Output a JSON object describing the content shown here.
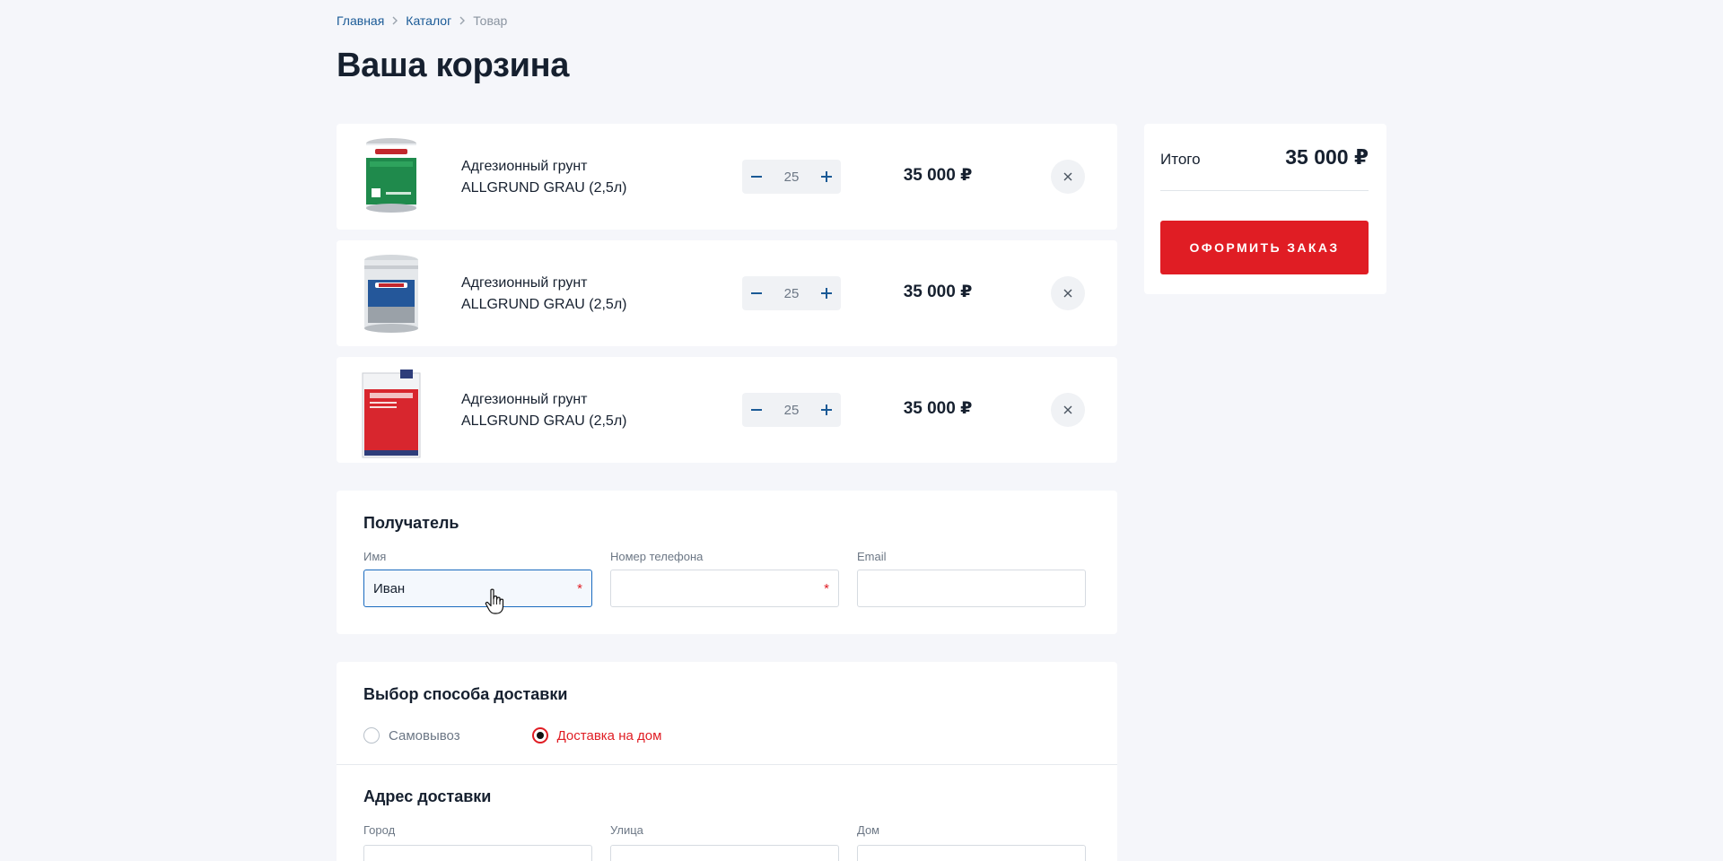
{
  "breadcrumb": {
    "home": "Главная",
    "catalog": "Каталог",
    "current": "Товар"
  },
  "page_title": "Ваша корзина",
  "cart": {
    "items": [
      {
        "name_line1": "Адгезионный грунт",
        "name_line2": "ALLGRUND GRAU (2,5л)",
        "qty": "25",
        "price": "35 000 ₽",
        "image": "green-paint-can"
      },
      {
        "name_line1": "Адгезионный грунт",
        "name_line2": "ALLGRUND GRAU (2,5л)",
        "qty": "25",
        "price": "35 000 ₽",
        "image": "silver-paint-bucket"
      },
      {
        "name_line1": "Адгезионный грунт",
        "name_line2": "ALLGRUND GRAU (2,5л)",
        "qty": "25",
        "price": "35 000 ₽",
        "image": "red-canister"
      }
    ]
  },
  "summary": {
    "total_label": "Итого",
    "total_value": "35 000 ₽",
    "order_button": "ОФОРМИТЬ ЗАКАЗ"
  },
  "recipient": {
    "title": "Получатель",
    "name_label": "Имя",
    "name_value": "Иван",
    "phone_label": "Номер телефона",
    "phone_value": "",
    "email_label": "Email",
    "email_value": "",
    "required_mark": "*"
  },
  "delivery": {
    "title": "Выбор способа доставки",
    "options": [
      "Самовывоз",
      "Доставка на дом"
    ],
    "selected": "Доставка на дом"
  },
  "address": {
    "title": "Адрес доставки",
    "city_label": "Город",
    "street_label": "Улица",
    "house_label": "Дом"
  },
  "colors": {
    "accent": "#e01d24",
    "link": "#1a5a96",
    "focus": "#1a6bbf"
  }
}
